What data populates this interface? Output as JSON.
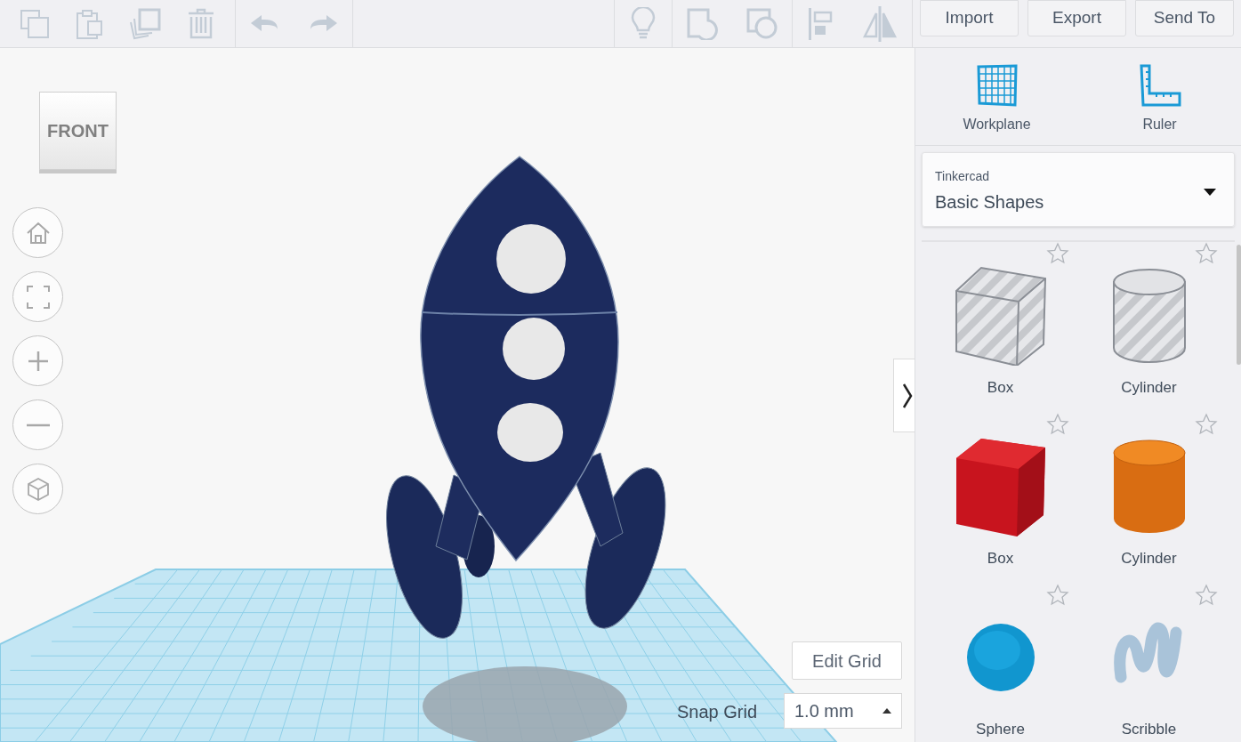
{
  "toolbar": {
    "buttons": [
      "Import",
      "Export",
      "Send To"
    ]
  },
  "view_cube": {
    "label": "FRONT"
  },
  "grid_controls": {
    "edit_button": "Edit Grid",
    "snap_label": "Snap Grid",
    "snap_value": "1.0 mm"
  },
  "right_panel": {
    "tools": [
      {
        "kind": "workplane",
        "label": "Workplane"
      },
      {
        "kind": "ruler",
        "label": "Ruler"
      }
    ],
    "library": {
      "source": "Tinkercad",
      "selection": "Basic Shapes"
    },
    "shapes": [
      {
        "kind": "box-hole",
        "label": "Box"
      },
      {
        "kind": "cylinder-hole",
        "label": "Cylinder"
      },
      {
        "kind": "box",
        "label": "Box"
      },
      {
        "kind": "cylinder",
        "label": "Cylinder"
      },
      {
        "kind": "sphere",
        "label": "Sphere"
      },
      {
        "kind": "scribble",
        "label": "Scribble"
      }
    ]
  }
}
